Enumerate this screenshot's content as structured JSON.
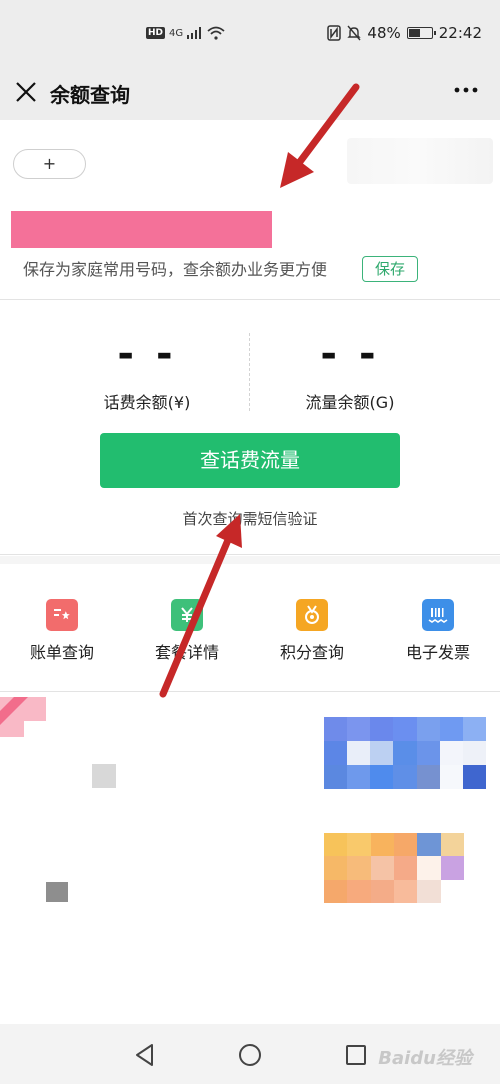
{
  "status_bar": {
    "network": "HD",
    "signal": "4G",
    "battery_percent": "48%",
    "time": "22:42"
  },
  "titlebar": {
    "title": "余额查询",
    "close_icon": "close-icon",
    "more_icon": "more-icon"
  },
  "phone": {
    "add_label": "+",
    "save_hint": "保存为家庭常用号码，查余额办业务更方便",
    "save_button": "保存"
  },
  "balance": {
    "call_value": "- -",
    "call_label": "话费余额(¥)",
    "data_value": "- -",
    "data_label": "流量余额(G)",
    "query_button": "查话费流量",
    "sms_note": "首次查询需短信验证"
  },
  "shortcuts": [
    {
      "label": "账单查询",
      "icon": "bill-icon",
      "color": "#f26c6c"
    },
    {
      "label": "套餐详情",
      "icon": "package-icon",
      "color": "#3ec07a"
    },
    {
      "label": "积分查询",
      "icon": "medal-icon",
      "color": "#f5a623"
    },
    {
      "label": "电子发票",
      "icon": "invoice-icon",
      "color": "#3d8fe8"
    }
  ],
  "colors": {
    "accent_green": "#22bd6f",
    "redacted_pink": "#f47199",
    "annotation_arrow": "#c62828"
  },
  "watermark": "Baidu经验"
}
